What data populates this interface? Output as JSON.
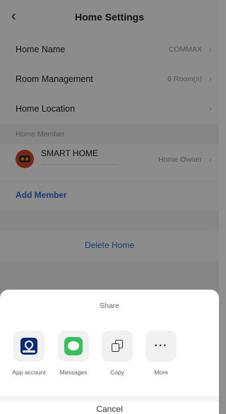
{
  "header": {
    "title": "Home Settings",
    "back_icon": "chevron-left-icon"
  },
  "rows": {
    "home_name": {
      "label": "Home Name",
      "value": "COMMAX"
    },
    "room_management": {
      "label": "Room Management",
      "value": "6 Room(s)"
    },
    "home_location": {
      "label": "Home Location",
      "value": ""
    }
  },
  "members_section": {
    "label": "Home Member"
  },
  "member": {
    "name": "SMART HOME",
    "role": "Home Owner"
  },
  "actions": {
    "add_member": "Add Member",
    "delete_home": "Delete Home"
  },
  "share_sheet": {
    "title": "Share",
    "apps": [
      {
        "label": "App account",
        "icon": "commax-app-icon"
      },
      {
        "label": "Messages",
        "icon": "messages-icon"
      },
      {
        "label": "Copy",
        "icon": "copy-icon"
      },
      {
        "label": "More",
        "icon": "more-icon",
        "glyph": "···"
      }
    ],
    "cancel": "Cancel"
  },
  "colors": {
    "accent": "#2a6fd4",
    "messages_green": "#35c25a",
    "commax_navy": "#0a2b78"
  }
}
